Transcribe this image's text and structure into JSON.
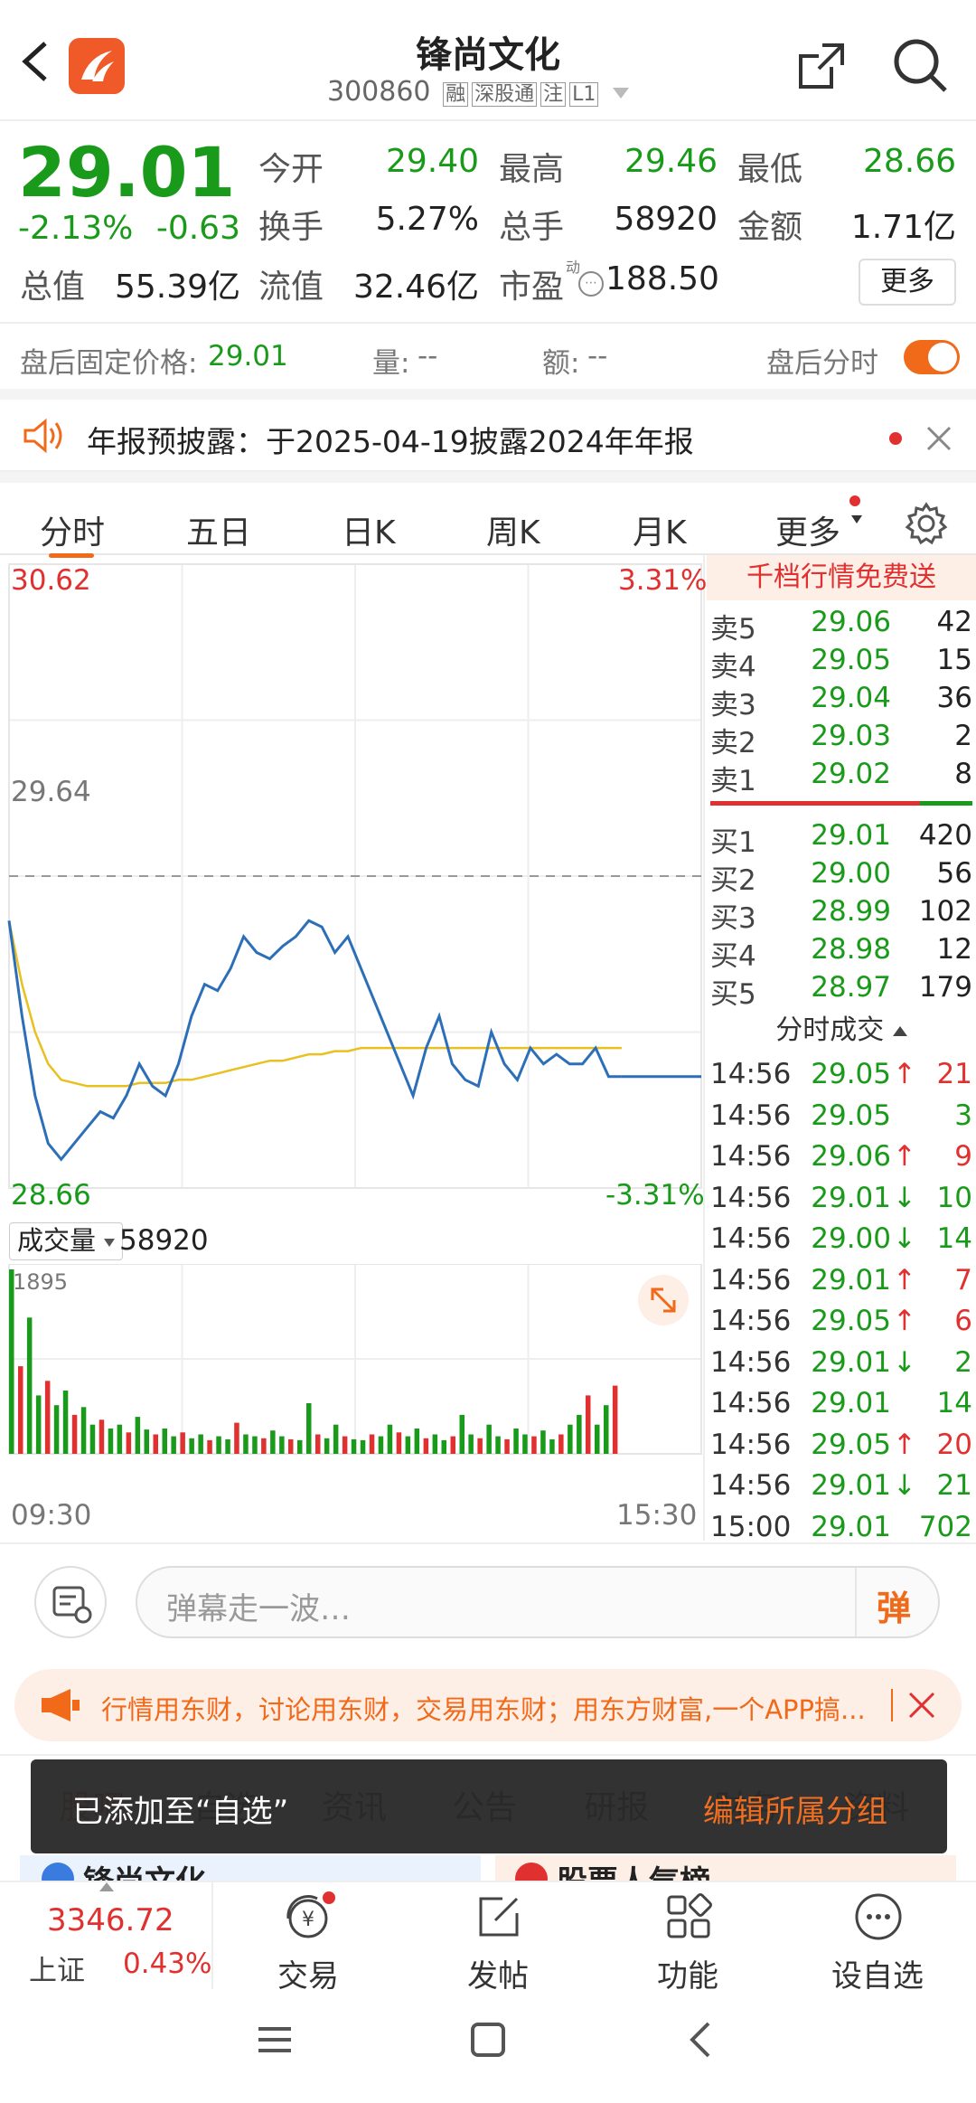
{
  "header": {
    "title": "锋尚文化",
    "code": "300860",
    "tags": [
      "融",
      "深股通",
      "注",
      "L1"
    ]
  },
  "quote": {
    "price": "29.01",
    "change_pct": "-2.13%",
    "change": "-0.63",
    "fields": [
      {
        "label": "今开",
        "value": "29.40",
        "color": "g"
      },
      {
        "label": "最高",
        "value": "29.46",
        "color": "g"
      },
      {
        "label": "最低",
        "value": "28.66",
        "color": "g"
      },
      {
        "label": "换手",
        "value": "5.27%",
        "color": "n"
      },
      {
        "label": "总手",
        "value": "58920",
        "color": "n"
      },
      {
        "label": "金额",
        "value": "1.71亿",
        "color": "n"
      },
      {
        "label": "总值",
        "value": "55.39亿",
        "color": "n"
      },
      {
        "label": "流值",
        "value": "32.46亿",
        "color": "n"
      },
      {
        "label": "市盈",
        "value": "188.50",
        "color": "n"
      }
    ],
    "pe_superscript": "动",
    "more_button": "更多"
  },
  "after_hours": {
    "price_label": "盘后固定价格:",
    "price": "29.01",
    "vol_label": "量:",
    "vol": "--",
    "amt_label": "额:",
    "amt": "--",
    "toggle_label": "盘后分时",
    "toggle_on": true
  },
  "notice": {
    "text": "年报预披露：于2025-04-19披露2024年年报"
  },
  "tabs": [
    "分时",
    "五日",
    "日K",
    "周K",
    "月K",
    "更多"
  ],
  "active_tab": "分时",
  "chart": {
    "top_left": "30.62",
    "top_right": "3.31%",
    "mid_label": "29.64",
    "bottom_left": "28.66",
    "bottom_right": "-3.31%",
    "volume_label": "成交量",
    "volume_total": "58920",
    "volume_max": "1895",
    "time_start": "09:30",
    "time_end": "15:30"
  },
  "chart_data": {
    "type": "line",
    "title": "",
    "ylim": [
      28.66,
      30.62
    ],
    "prev_close": 29.64,
    "series": [
      {
        "values": [
          29.5,
          29.2,
          28.95,
          28.8,
          28.75,
          28.8,
          28.85,
          28.9,
          28.88,
          28.95,
          29.05,
          28.98,
          28.95,
          29.05,
          29.2,
          29.3,
          29.28,
          29.35,
          29.45,
          29.4,
          29.38,
          29.42,
          29.45,
          29.5,
          29.48,
          29.4,
          29.45,
          29.35,
          29.25,
          29.15,
          29.05,
          28.95,
          29.1,
          29.2,
          29.05,
          29.0,
          28.98,
          29.15,
          29.05,
          29.0,
          29.1,
          29.05,
          29.08,
          29.05,
          29.05,
          29.1,
          29.01,
          29.01
        ]
      },
      {
        "values": [
          29.5,
          29.3,
          29.15,
          29.05,
          29.0,
          28.99,
          28.98,
          28.98,
          28.98,
          28.98,
          28.99,
          28.99,
          28.99,
          29.0,
          29.0,
          29.01,
          29.02,
          29.03,
          29.04,
          29.05,
          29.06,
          29.06,
          29.07,
          29.08,
          29.08,
          29.09,
          29.09,
          29.1,
          29.1,
          29.1,
          29.1,
          29.1,
          29.1,
          29.1,
          29.1,
          29.1,
          29.1,
          29.1,
          29.1,
          29.1,
          29.1,
          29.1,
          29.1,
          29.1,
          29.1,
          29.1,
          29.1,
          29.1
        ]
      }
    ]
  },
  "volume_data": [
    1895,
    900,
    1400,
    600,
    750,
    500,
    650,
    400,
    480,
    300,
    350,
    260,
    300,
    220,
    380,
    250,
    200,
    260,
    180,
    220,
    160,
    200,
    140,
    180,
    150,
    320,
    200,
    180,
    160,
    240,
    180,
    150,
    140,
    520,
    200,
    160,
    300,
    180,
    150,
    140,
    200,
    180,
    300,
    220,
    180,
    260,
    160,
    200,
    140,
    180,
    400,
    200,
    160,
    300,
    180,
    150,
    260,
    200,
    180,
    240,
    150,
    200,
    300,
    400,
    600,
    300,
    500,
    700
  ],
  "order_book": {
    "promo": "千档行情免费送",
    "sell": [
      {
        "label": "卖5",
        "price": "29.06",
        "vol": "42"
      },
      {
        "label": "卖4",
        "price": "29.05",
        "vol": "15"
      },
      {
        "label": "卖3",
        "price": "29.04",
        "vol": "36"
      },
      {
        "label": "卖2",
        "price": "29.03",
        "vol": "2"
      },
      {
        "label": "卖1",
        "price": "29.02",
        "vol": "8"
      }
    ],
    "buy": [
      {
        "label": "买1",
        "price": "29.01",
        "vol": "420"
      },
      {
        "label": "买2",
        "price": "29.00",
        "vol": "56"
      },
      {
        "label": "买3",
        "price": "28.99",
        "vol": "102"
      },
      {
        "label": "买4",
        "price": "28.98",
        "vol": "12"
      },
      {
        "label": "买5",
        "price": "28.97",
        "vol": "179"
      }
    ],
    "trades_title": "分时成交",
    "trades": [
      {
        "time": "14:56",
        "price": "29.05",
        "vol": "21",
        "dir": "up"
      },
      {
        "time": "14:56",
        "price": "29.05",
        "vol": "3",
        "dir": ""
      },
      {
        "time": "14:56",
        "price": "29.06",
        "vol": "9",
        "dir": "up"
      },
      {
        "time": "14:56",
        "price": "29.01",
        "vol": "10",
        "dir": "down"
      },
      {
        "time": "14:56",
        "price": "29.00",
        "vol": "14",
        "dir": "down"
      },
      {
        "time": "14:56",
        "price": "29.01",
        "vol": "7",
        "dir": "up"
      },
      {
        "time": "14:56",
        "price": "29.05",
        "vol": "6",
        "dir": "up"
      },
      {
        "time": "14:56",
        "price": "29.01",
        "vol": "2",
        "dir": "down"
      },
      {
        "time": "14:56",
        "price": "29.01",
        "vol": "14",
        "dir": ""
      },
      {
        "time": "14:56",
        "price": "29.05",
        "vol": "20",
        "dir": "up"
      },
      {
        "time": "14:56",
        "price": "29.01",
        "vol": "21",
        "dir": "down"
      },
      {
        "time": "15:00",
        "price": "29.01",
        "vol": "702",
        "dir": ""
      }
    ]
  },
  "danmu": {
    "placeholder": "弹幕走一波…",
    "send": "弹"
  },
  "ad": {
    "text": "行情用东财，讨论用东财，交易用东财；用东方财富,一个APP搞..."
  },
  "bottom_tabs": [
    "股吧",
    "自选",
    "资讯",
    "公告",
    "研报",
    "财务",
    "资料"
  ],
  "toast": {
    "text": "已添加至“自选”",
    "action": "编辑所属分组"
  },
  "under_cards": {
    "left": "锋尚文化",
    "right": "股票人气榜"
  },
  "nav": {
    "index_value": "3346.72",
    "index_name": "上证",
    "index_change": "0.43%",
    "items": [
      "交易",
      "发帖",
      "功能",
      "设自选"
    ]
  }
}
